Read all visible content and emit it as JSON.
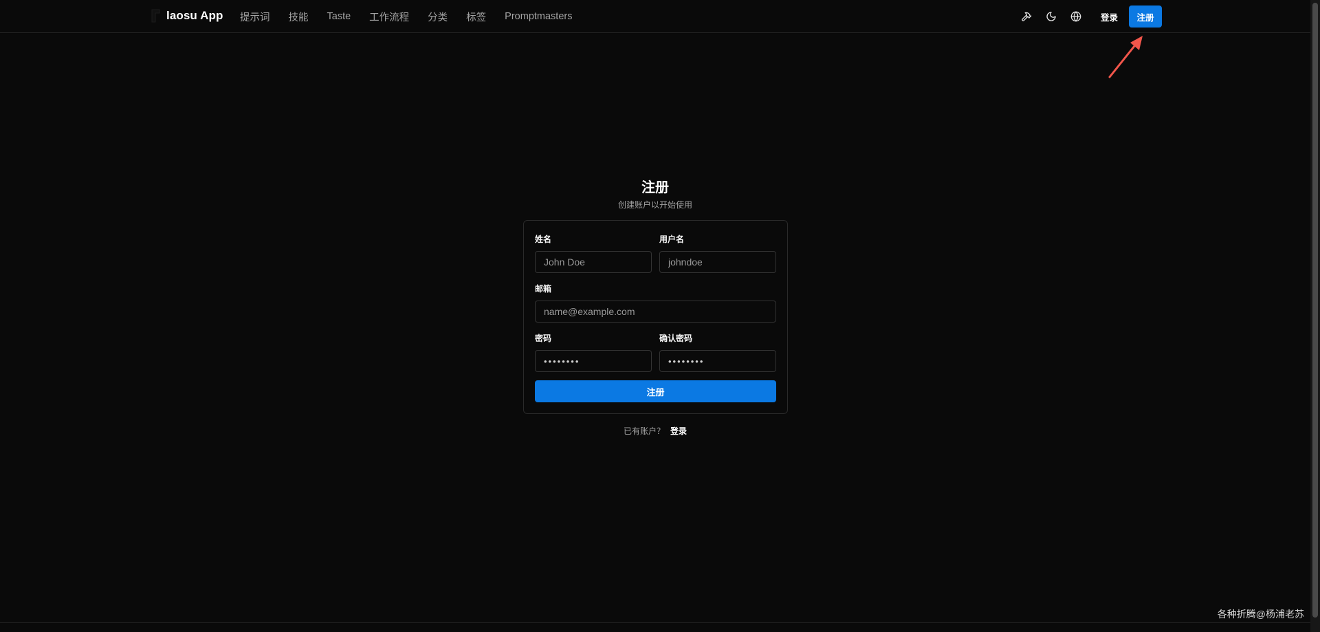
{
  "header": {
    "app_name": "laosu App",
    "nav": [
      "提示词",
      "技能",
      "Taste",
      "工作流程",
      "分类",
      "标签",
      "Promptmasters"
    ],
    "login_label": "登录",
    "signup_label": "注册",
    "icons": [
      "hammer-icon",
      "moon-icon",
      "globe-icon"
    ]
  },
  "form": {
    "title": "注册",
    "subtitle": "创建账户以开始使用",
    "name_label": "姓名",
    "name_placeholder": "John Doe",
    "username_label": "用户名",
    "username_placeholder": "johndoe",
    "email_label": "邮箱",
    "email_placeholder": "name@example.com",
    "password_label": "密码",
    "password_placeholder": "••••••••",
    "confirm_label": "确认密码",
    "confirm_placeholder": "••••••••",
    "submit_label": "注册"
  },
  "footer": {
    "prompt": "已有账户？",
    "login_label": "登录"
  },
  "watermark": "各种折腾@杨浦老苏",
  "colors": {
    "accent": "#0b79e3",
    "background": "#0a0a0a",
    "annotation_arrow": "#f2564b"
  }
}
